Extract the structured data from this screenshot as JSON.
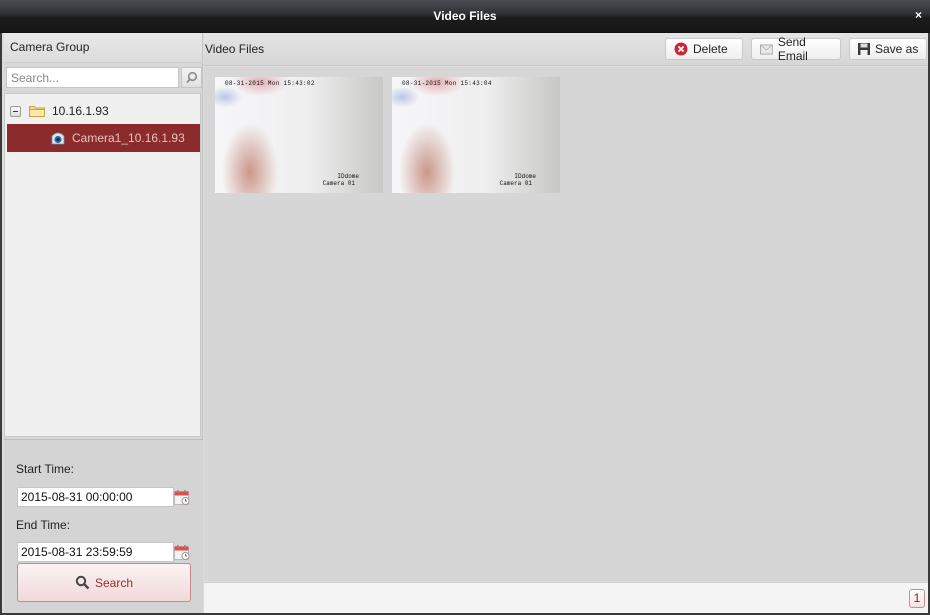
{
  "window": {
    "title": "Video Files",
    "close_label": "×"
  },
  "sidebar": {
    "title": "Camera Group",
    "search_placeholder": "Search...",
    "search_value": "",
    "tree": {
      "group_label": "10.16.1.93",
      "group_expanded": true,
      "camera_label": "Camera1_10.16.1.93",
      "camera_selected": true
    },
    "start_time_label": "Start Time:",
    "start_time_value": "2015-08-31 00:00:00",
    "end_time_label": "End Time:",
    "end_time_value": "2015-08-31 23:59:59",
    "search_button_label": "Search"
  },
  "main": {
    "title": "Video Files",
    "toolbar": {
      "delete_label": "Delete",
      "send_email_label": "Send Email",
      "save_as_label": "Save as"
    },
    "thumbnails": [
      {
        "osd_time": "08-31-2015 Mon 15:43:02",
        "osd_line1": "IDdome",
        "osd_line2": "Camera 01"
      },
      {
        "osd_time": "08-31-2015 Mon 15:43:04",
        "osd_line1": "IDdome",
        "osd_line2": "Camera 01"
      }
    ],
    "pagination": {
      "current_page": "1"
    }
  },
  "colors": {
    "selected_row": "#8b2b2b",
    "accent_red": "#a02a2a",
    "titlebar": "#1c1c1c"
  }
}
